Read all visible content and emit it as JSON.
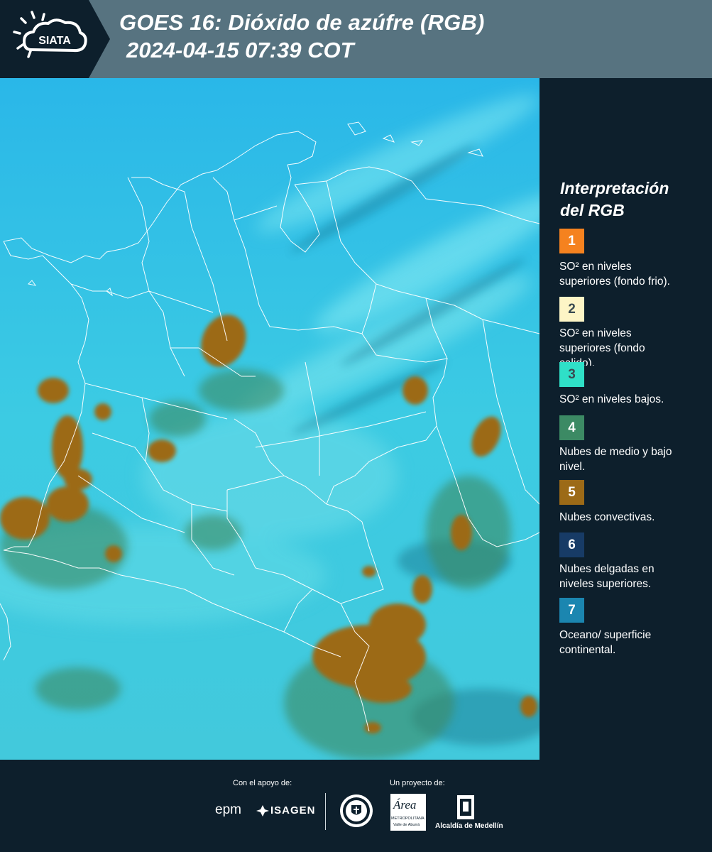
{
  "header": {
    "logo_text": "SIATA",
    "title_line1": "GOES 16: Dióxido de azúfre (RGB)",
    "title_line2": "2024-04-15 07:39 COT"
  },
  "legend": {
    "title_line1": "Interpretación",
    "title_line2": "del RGB",
    "items": [
      {
        "number": "1",
        "color": "#f5821f",
        "text_line1": "SO² en niveles",
        "text_line2": "superiores (fondo frio)."
      },
      {
        "number": "2",
        "color": "#fdf5c6",
        "text_line1": "SO² en niveles",
        "text_line2": "superiores (fondo",
        "text_line3": "calido)."
      },
      {
        "number": "3",
        "color": "#2fe0c8",
        "text_line1": "SO² en niveles bajos."
      },
      {
        "number": "4",
        "color": "#3c8a64",
        "text_line1": "Nubes de medio y bajo",
        "text_line2": "nivel."
      },
      {
        "number": "5",
        "color": "#9c6a17",
        "text_line1": "Nubes convectivas."
      },
      {
        "number": "6",
        "color": "#173b66",
        "text_line1": "Nubes delgadas en",
        "text_line2": "niveles superiores."
      },
      {
        "number": "7",
        "color": "#1b86b0",
        "text_line1": "Oceano/ superficie",
        "text_line2": "continental."
      }
    ]
  },
  "footer": {
    "support_label": "Con el apoyo de:",
    "project_label": "Un proyecto de:",
    "logo_epm": "epm",
    "logo_isagen": "ISAGEN",
    "logo_area_top": "Área",
    "logo_area_sub1": "METROPOLITANA",
    "logo_area_sub2": "Valle de Aburrá",
    "logo_alcaldia": "Alcaldía de Medellín",
    "logo_seal_text": "MEDELLÍN"
  },
  "colors": {
    "header_bg": "#577380",
    "panel_bg": "#0d1f2c",
    "map_base": "#33c6e6",
    "cloud_convective": "#9c6a17",
    "cloud_low": "#3c8a64"
  }
}
